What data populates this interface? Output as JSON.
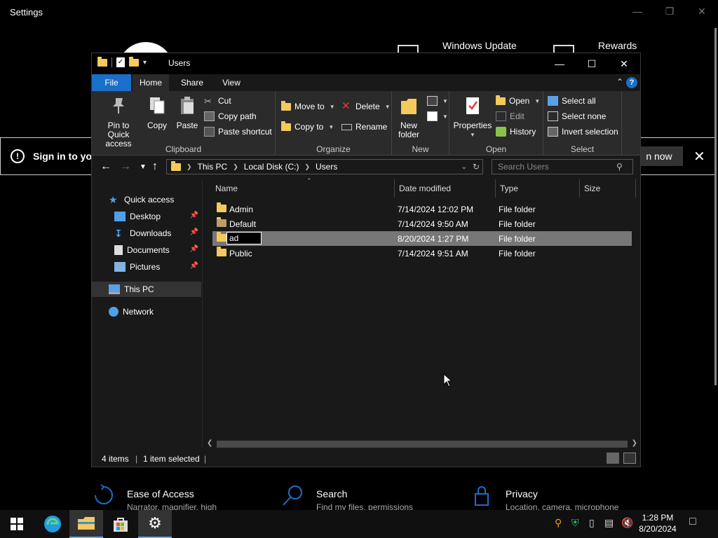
{
  "settings": {
    "title": "Settings",
    "top_items": [
      {
        "label": "Windows Update"
      },
      {
        "label": "Rewards"
      }
    ],
    "signin_banner": {
      "text": "Sign in to you",
      "button": "n now"
    },
    "bottom_items": [
      {
        "title": "Ease of Access",
        "subtitle": "Narrator, magnifier, high"
      },
      {
        "title": "Search",
        "subtitle": "Find my files, permissions"
      },
      {
        "title": "Privacy",
        "subtitle": "Location, camera, microphone"
      }
    ]
  },
  "explorer": {
    "title": "Users",
    "tabs": {
      "file": "File",
      "home": "Home",
      "share": "Share",
      "view": "View"
    },
    "ribbon": {
      "clipboard": {
        "label": "Clipboard",
        "pin": "Pin to Quick access",
        "copy": "Copy",
        "paste": "Paste",
        "cut": "Cut",
        "copy_path": "Copy path",
        "paste_shortcut": "Paste shortcut"
      },
      "organize": {
        "label": "Organize",
        "move_to": "Move to",
        "copy_to": "Copy to",
        "delete": "Delete",
        "rename": "Rename"
      },
      "new": {
        "label": "New",
        "new_folder": "New folder"
      },
      "open": {
        "label": "Open",
        "properties": "Properties",
        "open": "Open",
        "edit": "Edit",
        "history": "History"
      },
      "select": {
        "label": "Select",
        "select_all": "Select all",
        "select_none": "Select none",
        "invert": "Invert selection"
      }
    },
    "address": {
      "crumbs": [
        "This PC",
        "Local Disk (C:)",
        "Users"
      ],
      "search_placeholder": "Search Users"
    },
    "nav": {
      "quick_access": "Quick access",
      "desktop": "Desktop",
      "downloads": "Downloads",
      "documents": "Documents",
      "pictures": "Pictures",
      "this_pc": "This PC",
      "network": "Network"
    },
    "columns": {
      "name": "Name",
      "date": "Date modified",
      "type": "Type",
      "size": "Size"
    },
    "files": [
      {
        "name": "Admin",
        "date": "7/14/2024 12:02 PM",
        "type": "File folder"
      },
      {
        "name": "Default",
        "date": "7/14/2024 9:50 AM",
        "type": "File folder"
      },
      {
        "name": "ad",
        "date": "8/20/2024 1:27 PM",
        "type": "File folder"
      },
      {
        "name": "Public",
        "date": "7/14/2024 9:51 AM",
        "type": "File folder"
      }
    ],
    "status": {
      "items": "4 items",
      "selected": "1 item selected"
    }
  },
  "taskbar": {
    "time": "1:28 PM",
    "date": "8/20/2024"
  },
  "colors": {
    "accent": "#1a6fc9",
    "folder": "#f4c95d",
    "window_bg": "#191919",
    "ribbon_bg": "#2b2b2b"
  }
}
